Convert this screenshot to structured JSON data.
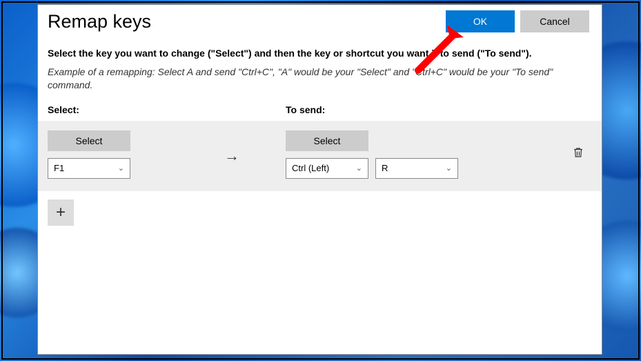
{
  "header": {
    "title": "Remap keys",
    "ok_label": "OK",
    "cancel_label": "Cancel"
  },
  "instructions": "Select the key you want to change (\"Select\") and then the key or shortcut you want it to send (\"To send\").",
  "example": "Example of a remapping: Select A and send \"Ctrl+C\", \"A\" would be your \"Select\" and \"Ctrl+C\" would be your \"To send\" command.",
  "columns": {
    "select_label": "Select:",
    "tosend_label": "To send:"
  },
  "row": {
    "select_button": "Select",
    "from_key": "F1",
    "to_select_button": "Select",
    "to_mod": "Ctrl (Left)",
    "to_key": "R"
  },
  "icons": {
    "arrow": "→",
    "plus": "+"
  }
}
